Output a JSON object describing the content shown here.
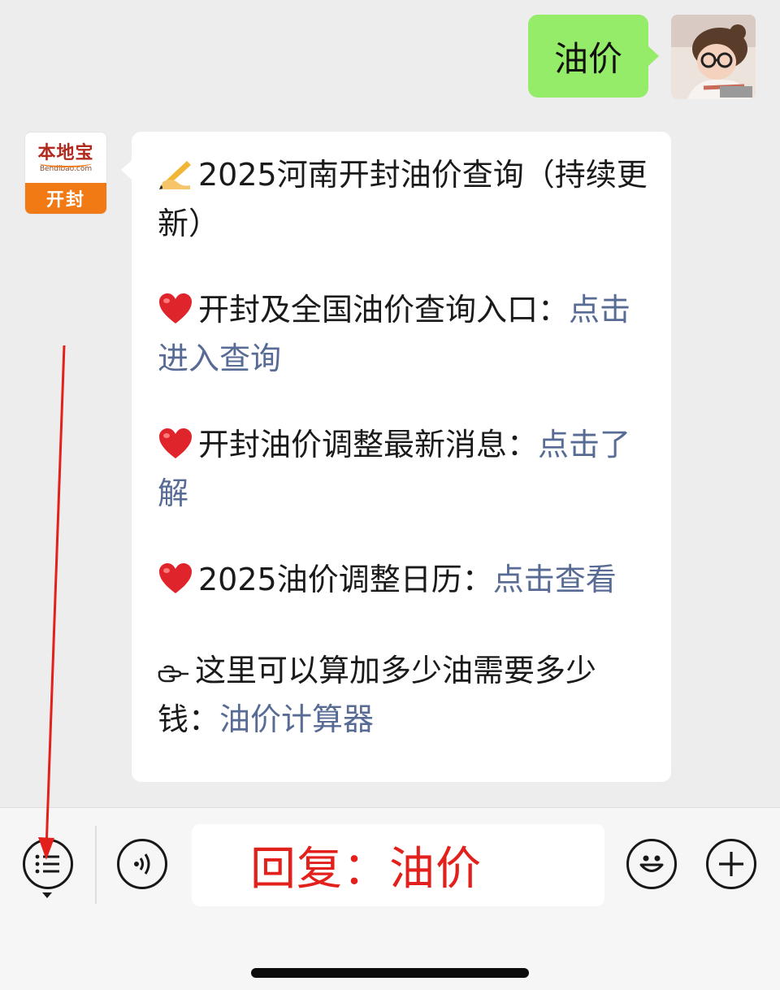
{
  "outgoing": {
    "text": "油价"
  },
  "incoming": {
    "brand": {
      "name": "本地宝",
      "domain": "Bendibao.com",
      "city": "开封"
    },
    "paragraphs": [
      {
        "prefix_icon": "writing-hand-icon",
        "text": "2025河南开封油价查询（持续更新）",
        "link": ""
      },
      {
        "prefix_icon": "red-heart-icon",
        "text": "开封及全国油价查询入口：",
        "link": "点击进入查询"
      },
      {
        "prefix_icon": "red-heart-icon",
        "text": "开封油价调整最新消息：",
        "link": "点击了解"
      },
      {
        "prefix_icon": "red-heart-icon",
        "text": "2025油价调整日历：",
        "link": "点击查看"
      },
      {
        "prefix_icon": "pointing-hand-icon",
        "text": "这里可以算加多少油需要多少钱：",
        "link": "油价计算器"
      }
    ]
  },
  "input_bar": {
    "text": "回复：油价",
    "icons": [
      "menu-list-icon",
      "voice-icon",
      "emoji-face-icon",
      "plus-icon"
    ]
  },
  "colors": {
    "background": "#ededed",
    "outgoing_bubble": "#95ec69",
    "incoming_bubble": "#ffffff",
    "link": "#576b95",
    "brand_orange": "#f27a14",
    "annotation_red": "#e3211c"
  }
}
